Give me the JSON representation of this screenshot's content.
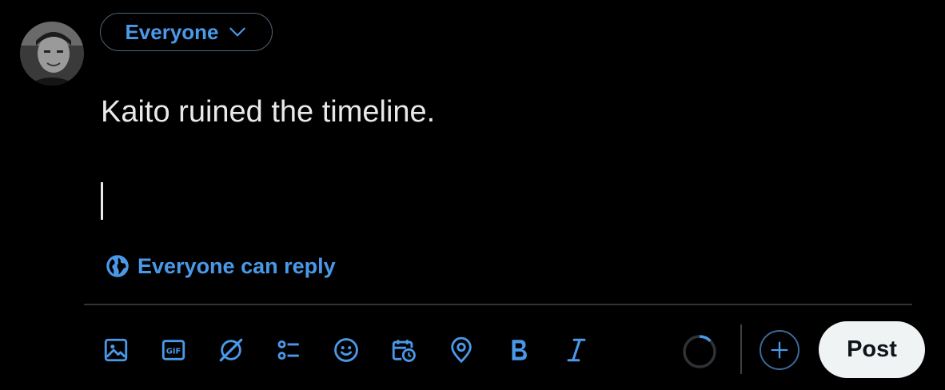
{
  "composer": {
    "audience_label": "Everyone",
    "text": "Kaito ruined the timeline.",
    "reply_setting": "Everyone can reply",
    "post_label": "Post"
  },
  "toolbar": {
    "icons": [
      "image-icon",
      "gif-icon",
      "grok-icon",
      "poll-icon",
      "emoji-icon",
      "schedule-icon",
      "location-icon",
      "bold-icon",
      "italic-icon"
    ]
  },
  "colors": {
    "background": "#000000",
    "accent": "#4a99e9",
    "text": "#e7e9ea",
    "post_button": "#eff3f4"
  }
}
